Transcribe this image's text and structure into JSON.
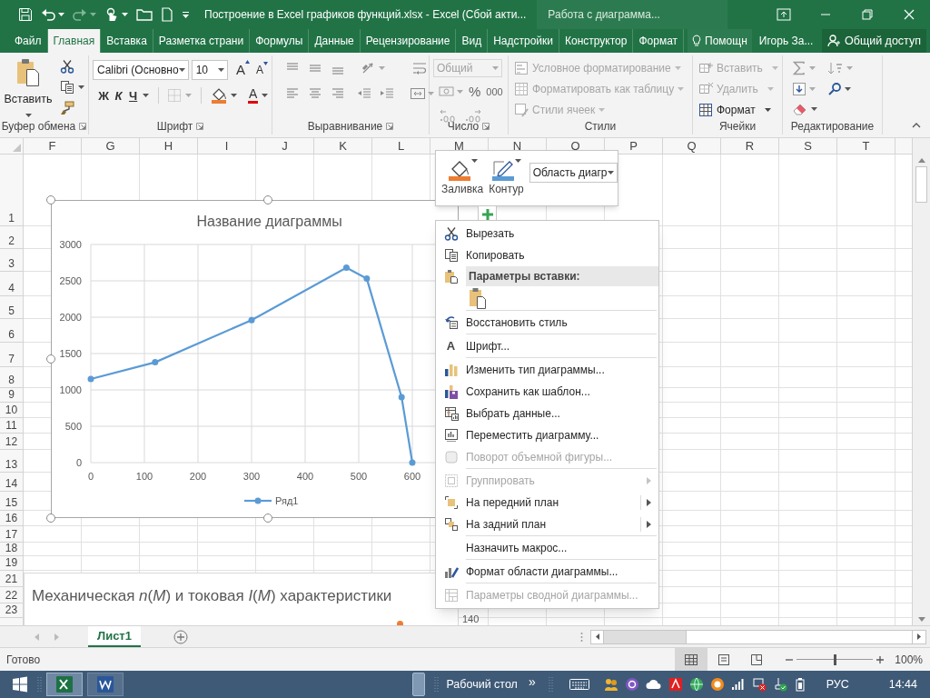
{
  "title_bar": {
    "title": "Построение в Excel графиков функций.xlsx - Excel (Сбой акти...",
    "context_title": "Работа с диаграмма..."
  },
  "tabs": [
    {
      "label": "Файл",
      "selected": false
    },
    {
      "label": "Главная",
      "selected": true
    },
    {
      "label": "Вставка",
      "selected": false
    },
    {
      "label": "Разметка страни",
      "selected": false
    },
    {
      "label": "Формулы",
      "selected": false
    },
    {
      "label": "Данные",
      "selected": false
    },
    {
      "label": "Рецензирование",
      "selected": false
    },
    {
      "label": "Вид",
      "selected": false
    },
    {
      "label": "Надстройки",
      "selected": false
    },
    {
      "label": "Конструктор",
      "selected": false
    },
    {
      "label": "Формат",
      "selected": false
    }
  ],
  "tell_me": "Помощн",
  "user": "Игорь За...",
  "share_button": "Общий доступ",
  "ribbon": {
    "clipboard": {
      "label": "Буфер обмена",
      "paste": "Вставить"
    },
    "font": {
      "label": "Шрифт",
      "font_name": "Calibri (Основно",
      "font_size": "10",
      "grow": "A",
      "shrink": "A",
      "bold": "Ж",
      "italic": "К",
      "underline": "Ч",
      "font_color": "A"
    },
    "alignment": {
      "label": "Выравнивание"
    },
    "number": {
      "label": "Число",
      "format": {
        "value": "Общий",
        "disabled": true
      },
      "percent": "%",
      "thousands": "000"
    },
    "styles": {
      "label": "Стили",
      "items": [
        {
          "text": "Условное форматирование",
          "disabled": true
        },
        {
          "text": "Форматировать как таблицу",
          "disabled": true
        },
        {
          "text": "Стили ячеек",
          "disabled": true
        }
      ]
    },
    "cells": {
      "label": "Ячейки",
      "items": [
        {
          "text": "Вставить",
          "disabled": true
        },
        {
          "text": "Удалить",
          "disabled": true
        },
        {
          "text": "Формат",
          "disabled": false
        }
      ]
    },
    "editing": {
      "label": "Редактирование"
    }
  },
  "sheet": {
    "columns": [
      "F",
      "G",
      "H",
      "I",
      "J",
      "K",
      "L",
      "M",
      "N",
      "O",
      "P",
      "Q",
      "R",
      "S",
      "T"
    ],
    "rows": [
      "1",
      "2",
      "3",
      "4",
      "5",
      "6",
      "7",
      "8",
      "9",
      "10",
      "11",
      "12",
      "13",
      "14",
      "15",
      "16",
      "17",
      "18",
      "19",
      "21",
      "22",
      "23"
    ]
  },
  "chart": {
    "chart_data": {
      "type": "line",
      "title": "Название диаграммы",
      "x": [
        0,
        120,
        300,
        477,
        515,
        580,
        600
      ],
      "series": [
        {
          "name": "Ряд1",
          "color": "#5b9bd5",
          "marker": "circle",
          "values": [
            1150,
            1380,
            1960,
            2680,
            2530,
            900,
            0
          ]
        }
      ],
      "xlim": [
        0,
        700
      ],
      "ylim": [
        0,
        3000
      ],
      "grid": true,
      "xticks": [
        0,
        100,
        200,
        300,
        400,
        500,
        600
      ],
      "yticks": [
        0,
        500,
        1000,
        1500,
        2000,
        2500,
        3000
      ]
    }
  },
  "second_chart": {
    "title": "Механическая *n*(*M*) и токовая *I*(*M*) характеристики",
    "axis_label": "140"
  },
  "mini_toolbar": {
    "fill": "Заливка",
    "outline": "Контур",
    "element": "Область диагр"
  },
  "context_menu": {
    "groups": [
      [
        {
          "kind": "command",
          "text": "Вырезать",
          "disabled": false,
          "submenu": false
        },
        {
          "kind": "command",
          "text": "Копировать",
          "disabled": false,
          "submenu": false
        },
        {
          "kind": "header",
          "text": "Параметры вставки:"
        },
        {
          "kind": "paste_options"
        }
      ],
      [
        {
          "kind": "command",
          "text": "Восстановить стиль",
          "disabled": false,
          "submenu": false
        }
      ],
      [
        {
          "kind": "command",
          "text": "Шрифт...",
          "glyph": "A",
          "disabled": false,
          "submenu": false
        }
      ],
      [
        {
          "kind": "command",
          "text": "Изменить тип диаграммы...",
          "disabled": false,
          "submenu": false
        },
        {
          "kind": "command",
          "text": "Сохранить как шаблон...",
          "disabled": false,
          "submenu": false
        },
        {
          "kind": "command",
          "text": "Выбрать данные...",
          "disabled": false,
          "submenu": false
        },
        {
          "kind": "command",
          "text": "Переместить диаграмму...",
          "disabled": false,
          "submenu": false
        },
        {
          "kind": "command",
          "text": "Поворот объемной фигуры...",
          "disabled": true,
          "submenu": false
        }
      ],
      [
        {
          "kind": "command",
          "text": "Группировать",
          "disabled": true,
          "submenu": true
        },
        {
          "kind": "command",
          "text": "На передний план",
          "disabled": false,
          "submenu": true
        },
        {
          "kind": "command",
          "text": "На задний план",
          "disabled": false,
          "submenu": true
        }
      ],
      [
        {
          "kind": "command",
          "text": "Назначить макрос...",
          "disabled": false,
          "submenu": false
        }
      ],
      [
        {
          "kind": "command",
          "text": "Формат области диаграммы...",
          "disabled": false,
          "submenu": false
        }
      ],
      [
        {
          "kind": "command",
          "text": "Параметры сводной диаграммы...",
          "disabled": true,
          "submenu": false
        }
      ]
    ]
  },
  "sheet_tabs": [
    {
      "label": "Лист1",
      "selected": true
    }
  ],
  "status_bar": {
    "status": "Готово",
    "views": [
      {
        "selected": true
      },
      {
        "selected": false
      },
      {
        "selected": false
      }
    ],
    "zoom": {
      "level": 0.5,
      "reading": "100%"
    }
  },
  "taskbar": {
    "apps": [
      {
        "kind": "excel",
        "selected": true
      },
      {
        "kind": "word",
        "selected": false
      }
    ],
    "toolbar": "Рабочий стол",
    "chevron": "»",
    "language": "РУС",
    "time": "14:44"
  }
}
